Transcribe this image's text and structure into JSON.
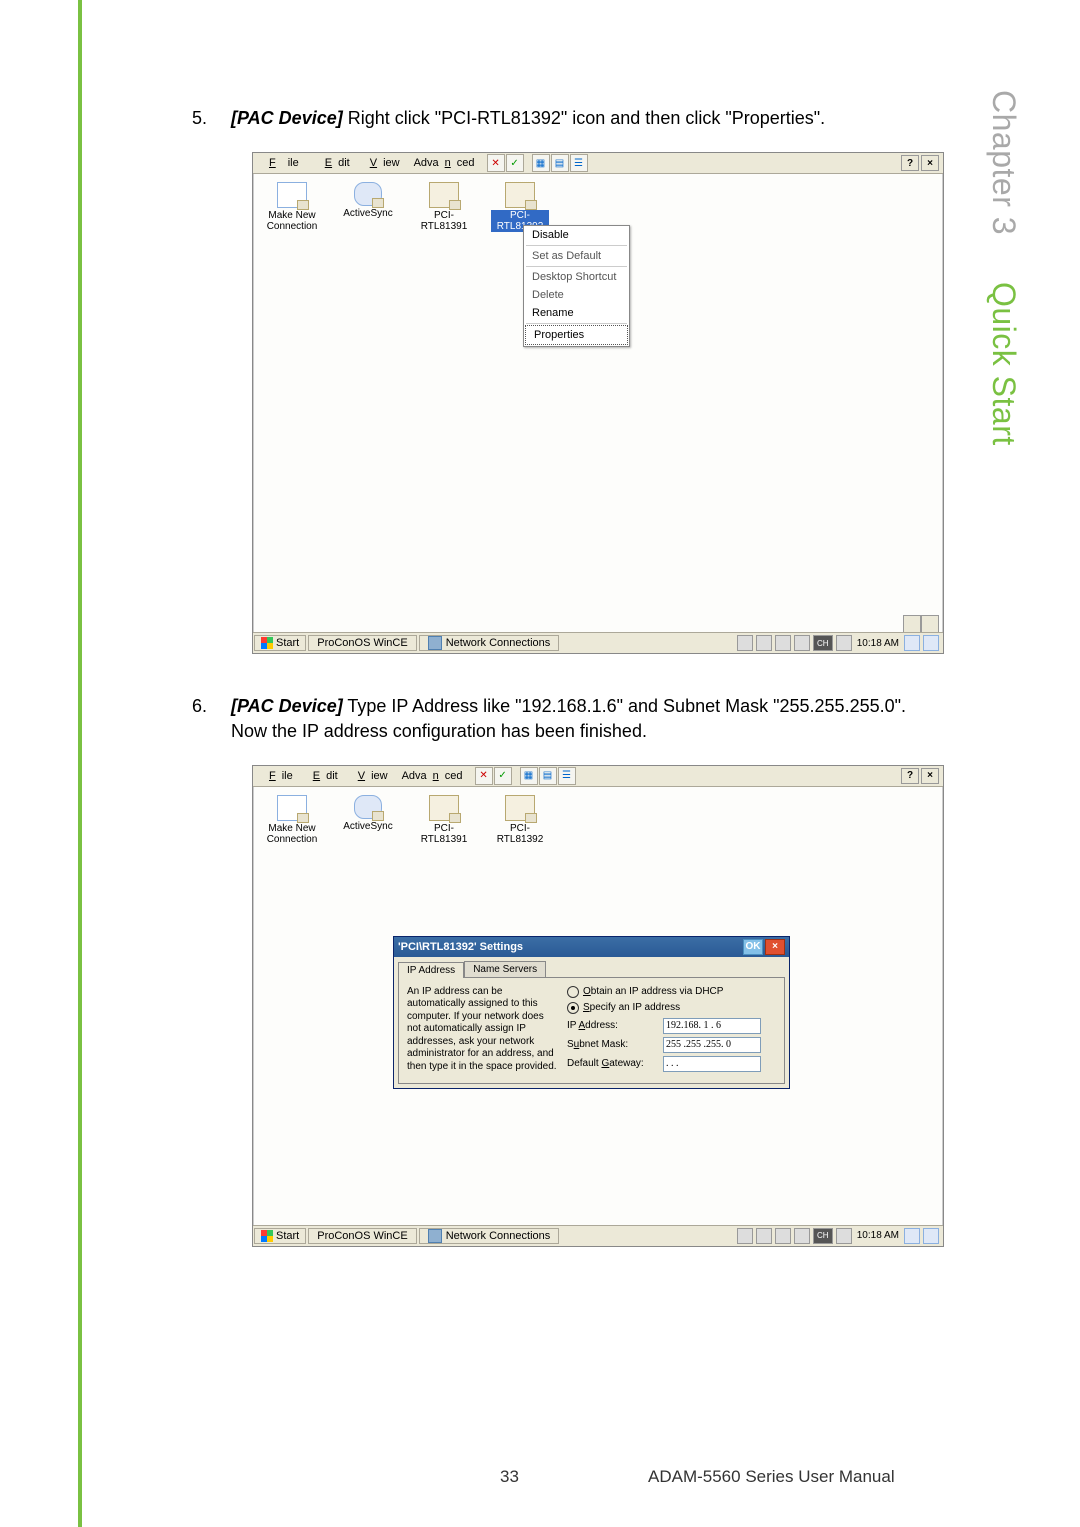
{
  "side_heading_chapter": "Chapter 3",
  "side_heading_title": "Quick Start",
  "steps": {
    "s5_num": "5.",
    "s5_tag": "[PAC Device]",
    "s5_text": " Right click \"PCI-RTL81392\" icon and then click \"Properties\".",
    "s6_num": "6.",
    "s6_tag": "[PAC Device]",
    "s6_text": " Type IP Address like \"192.168.1.6\" and Subnet Mask \"255.255.255.0\". Now the IP address configuration has been finished."
  },
  "menu": {
    "file": "File",
    "edit": "Edit",
    "view": "View",
    "advanced": "Advanced"
  },
  "icons": {
    "make": "Make New\nConnection",
    "sync": "ActiveSync",
    "pci1": "PCI-\nRTL81391",
    "pci2": "PCI-\nRTL81392"
  },
  "context": {
    "disable": "Disable",
    "setdefault": "Set as Default",
    "shortcut": "Desktop Shortcut",
    "delete": "Delete",
    "rename": "Rename",
    "properties": "Properties"
  },
  "taskbar": {
    "start": "Start",
    "task1": "ProConOS WinCE",
    "task2": "Network Connections",
    "ch": "CH",
    "time": "10:18 AM"
  },
  "win": {
    "help": "?",
    "close": "×"
  },
  "dialog": {
    "title": "'PCI\\RTL81392' Settings",
    "ok": "OK",
    "x": "×",
    "tab_ip": "IP Address",
    "tab_ns": "Name Servers",
    "desc": "An IP address can be automatically assigned to this computer. If your network does not automatically assign IP addresses, ask your network administrator for an address, and then type it in the space provided.",
    "radio_dhcp": "Obtain an IP address via DHCP",
    "radio_specify": "Specify an IP address",
    "lbl_ip": "IP Address:",
    "lbl_mask": "Subnet Mask:",
    "lbl_gw": "Default Gateway:",
    "val_ip": "192.168.  1  .  6",
    "val_mask": "255 .255 .255.  0",
    "val_gw": ".      .      ."
  },
  "footer": {
    "page": "33",
    "doc": "ADAM-5560 Series User Manual"
  }
}
